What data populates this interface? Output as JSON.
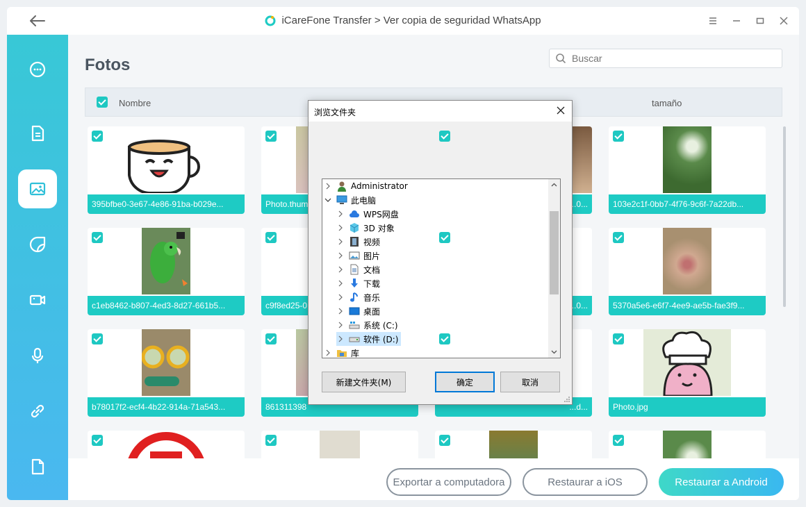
{
  "window": {
    "title": "iCareFone Transfer > Ver copia de seguridad WhatsApp"
  },
  "main": {
    "page_title": "Fotos",
    "search_placeholder": "Buscar",
    "columns": {
      "name": "Nombre",
      "size": "tamaño"
    }
  },
  "sidebar": {
    "items": [
      {
        "icon": "chat-icon"
      },
      {
        "icon": "document-icon"
      },
      {
        "icon": "image-icon",
        "active": true
      },
      {
        "icon": "sticker-icon"
      },
      {
        "icon": "video-icon"
      },
      {
        "icon": "microphone-icon"
      },
      {
        "icon": "link-icon"
      },
      {
        "icon": "file-icon"
      }
    ]
  },
  "photos": [
    "395bfbe0-3e67-4e86-91ba-b029e...",
    "Photo.thumb",
    "...0...",
    "103e2c1f-0bb7-4f76-9c6f-7a22db...",
    "c1eb8462-b807-4ed3-8d27-661b5...",
    "c9f8ed25-0",
    "...0...",
    "5370a5e6-e6f7-4ee9-ae5b-fae3f9...",
    "b78017f2-ecf4-4b22-914a-71a543...",
    "861311398",
    "...d...",
    "Photo.jpg"
  ],
  "bottom": {
    "export": "Exportar a computadora",
    "restore_ios": "Restaurar a iOS",
    "restore_android": "Restaurar a Android"
  },
  "dialog": {
    "title": "浏览文件夹",
    "tree": [
      "Administrator",
      "此电脑",
      "WPS网盘",
      "3D 对象",
      "视频",
      "图片",
      "文档",
      "下载",
      "音乐",
      "桌面",
      "系统 (C:)",
      "软件 (D:)",
      "库"
    ],
    "new_folder": "新建文件夹(M)",
    "ok": "确定",
    "cancel": "取消"
  },
  "colors": {
    "accent": "#1ecbc4",
    "sidebar_top": "#38c8d6",
    "sidebar_bottom": "#4ab8f0"
  }
}
